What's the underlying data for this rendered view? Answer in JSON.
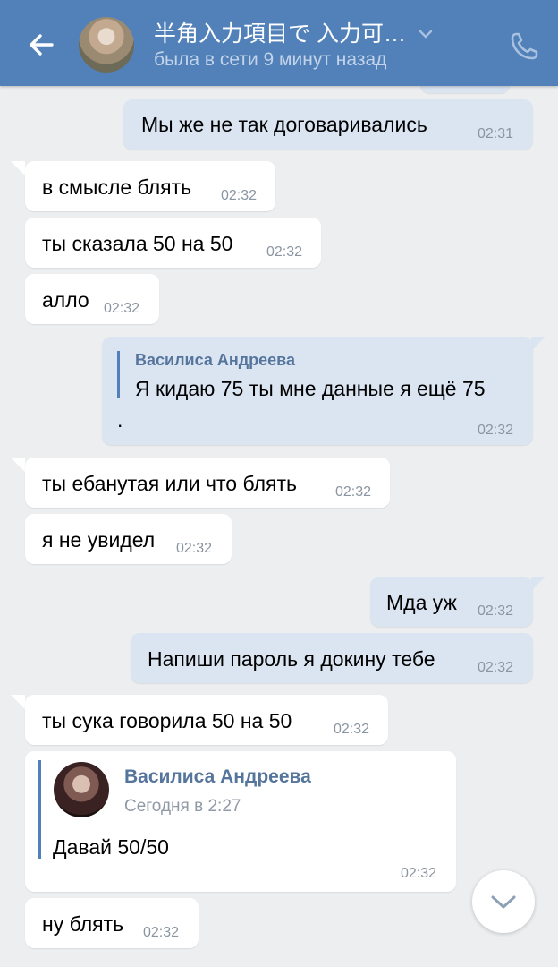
{
  "header": {
    "title": "半角入力項目で 入力可…",
    "status": "была в сети 9 минут назад",
    "back_icon": "arrow-left-icon",
    "chevron_icon": "chevron-down-icon",
    "call_icon": "phone-icon"
  },
  "messages": [
    {
      "dir": "out",
      "text": "Мы же не так договаривались",
      "time": "02:31"
    },
    {
      "dir": "in",
      "text": "в смысле блять",
      "time": "02:32"
    },
    {
      "dir": "in",
      "text": "ты сказала 50 на 50",
      "time": "02:32"
    },
    {
      "dir": "in",
      "text": "алло",
      "time": "02:32"
    },
    {
      "dir": "out",
      "reply_author": "Василиса Андреева",
      "reply_text": "Я кидаю 75 ты мне данные я ещё 75",
      "text": ".",
      "time": "02:32"
    },
    {
      "dir": "in",
      "text": "ты ебанутая или что блять",
      "time": "02:32"
    },
    {
      "dir": "in",
      "text": "я не увидел",
      "time": "02:32"
    },
    {
      "dir": "out",
      "text": "Мда уж",
      "time": "02:32"
    },
    {
      "dir": "out",
      "text": "Напиши пароль я докину тебе",
      "time": "02:32"
    },
    {
      "dir": "in",
      "text": "ты сука говорила 50 на 50",
      "time": "02:32"
    },
    {
      "dir": "in",
      "fwd_author": "Василиса Андреева",
      "fwd_date": "Сегодня в 2:27",
      "fwd_text": "Давай 50/50",
      "time": "02:32"
    },
    {
      "dir": "in",
      "text": "ну блять",
      "time": "02:32"
    }
  ],
  "colors": {
    "header": "#5181b8",
    "background": "#edeef0",
    "out_bubble": "#dbe5f2",
    "in_bubble": "#ffffff"
  }
}
